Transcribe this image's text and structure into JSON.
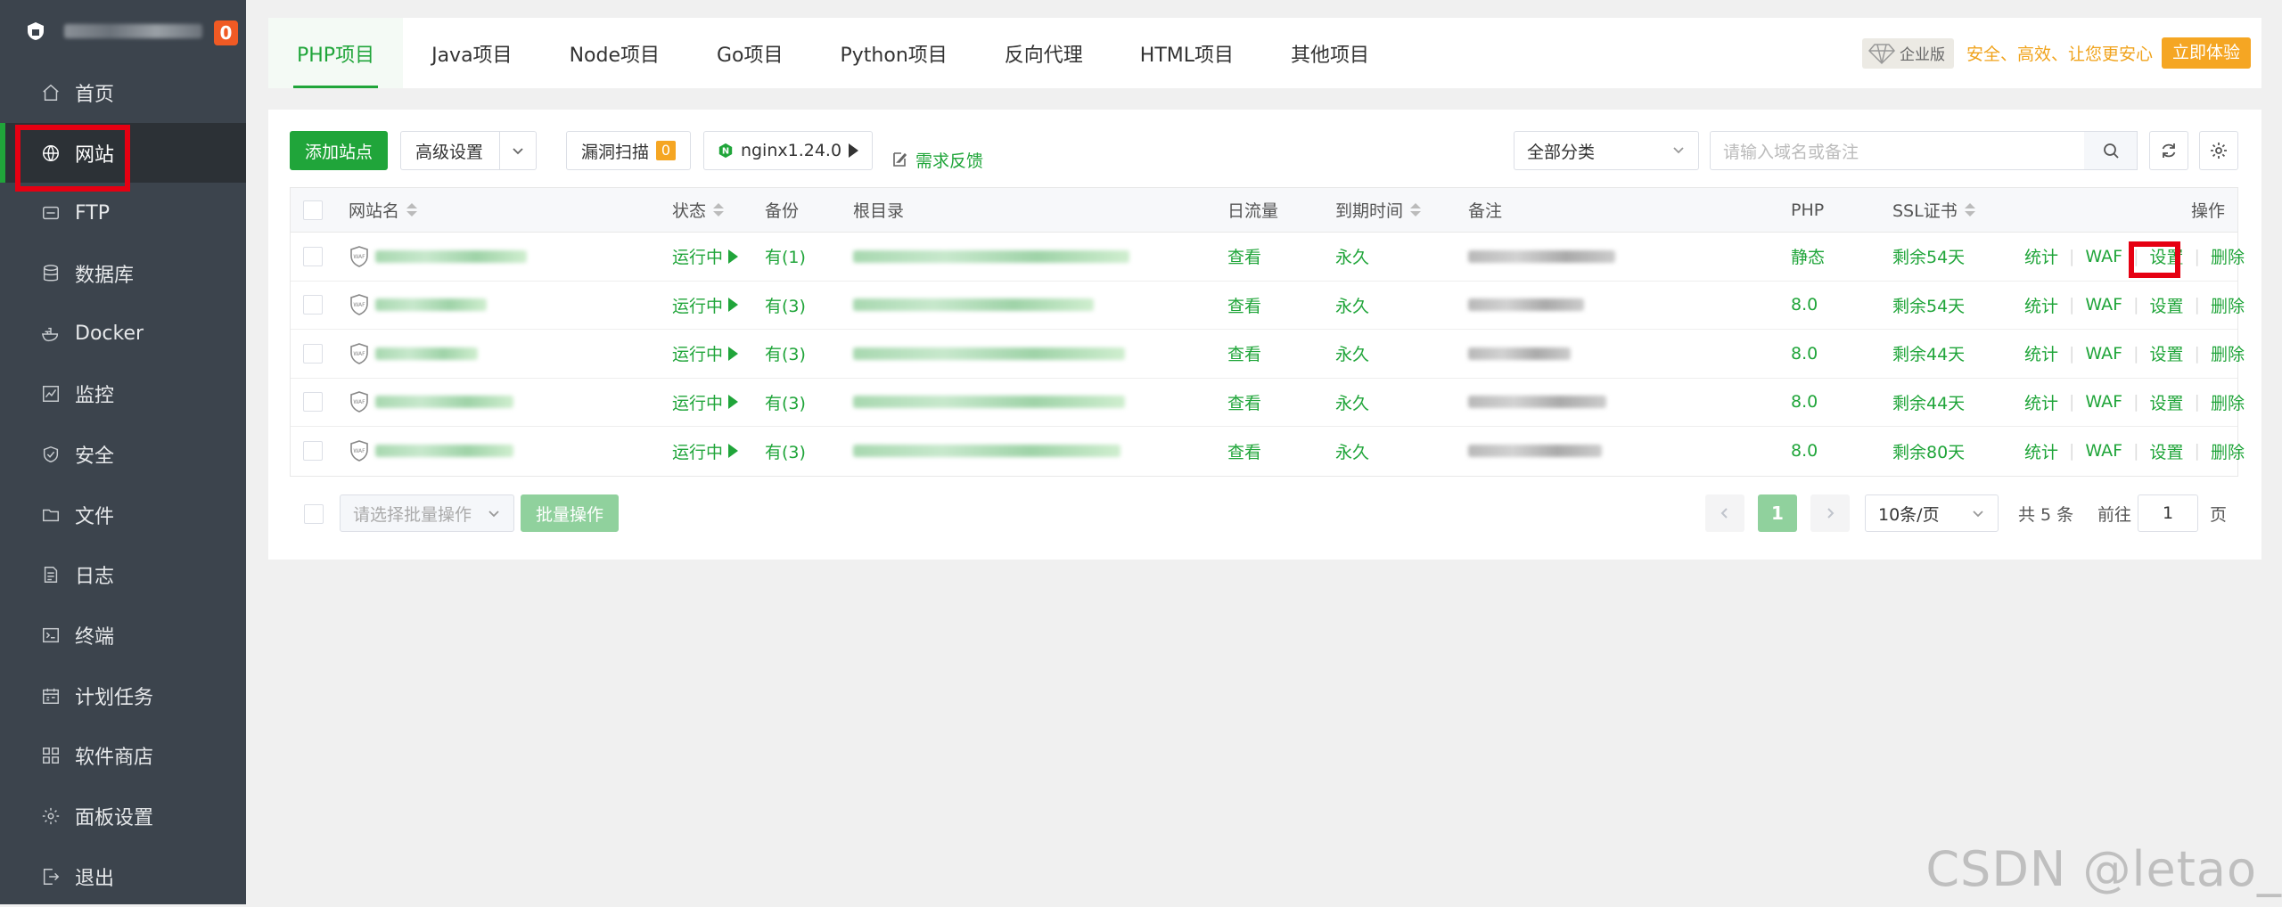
{
  "sidebar": {
    "badge": "0",
    "items": [
      {
        "label": "首页",
        "icon": "home-icon"
      },
      {
        "label": "网站",
        "icon": "globe-icon",
        "active": true
      },
      {
        "label": "FTP",
        "icon": "ftp-icon"
      },
      {
        "label": "数据库",
        "icon": "database-icon"
      },
      {
        "label": "Docker",
        "icon": "docker-icon"
      },
      {
        "label": "监控",
        "icon": "monitor-icon"
      },
      {
        "label": "安全",
        "icon": "shield-icon"
      },
      {
        "label": "文件",
        "icon": "folder-icon"
      },
      {
        "label": "日志",
        "icon": "log-icon"
      },
      {
        "label": "终端",
        "icon": "terminal-icon"
      },
      {
        "label": "计划任务",
        "icon": "calendar-icon"
      },
      {
        "label": "软件商店",
        "icon": "grid-icon"
      },
      {
        "label": "面板设置",
        "icon": "gear-icon"
      },
      {
        "label": "退出",
        "icon": "logout-icon"
      }
    ]
  },
  "tabs": [
    "PHP项目",
    "Java项目",
    "Node项目",
    "Go项目",
    "Python项目",
    "反向代理",
    "HTML项目",
    "其他项目"
  ],
  "promo": {
    "edition": "企业版",
    "slogan": "安全、高效、让您更安心",
    "button": "立即体验"
  },
  "toolbar": {
    "add_site": "添加站点",
    "advanced": "高级设置",
    "vuln_scan": "漏洞扫描",
    "vuln_count": "0",
    "nginx": "nginx1.24.0",
    "feedback": "需求反馈",
    "category": "全部分类",
    "search_placeholder": "请输入域名或备注"
  },
  "table": {
    "headers": {
      "name": "网站名",
      "status": "状态",
      "backup": "备份",
      "root": "根目录",
      "traffic": "日流量",
      "expire": "到期时间",
      "note": "备注",
      "php": "PHP",
      "ssl": "SSL证书",
      "ops": "操作"
    },
    "rows": [
      {
        "status": "运行中",
        "backup": "有(1)",
        "traffic": "查看",
        "expire": "永久",
        "php": "静态",
        "ssl": "剩余54天"
      },
      {
        "status": "运行中",
        "backup": "有(3)",
        "traffic": "查看",
        "expire": "永久",
        "php": "8.0",
        "ssl": "剩余54天"
      },
      {
        "status": "运行中",
        "backup": "有(3)",
        "traffic": "查看",
        "expire": "永久",
        "php": "8.0",
        "ssl": "剩余44天"
      },
      {
        "status": "运行中",
        "backup": "有(3)",
        "traffic": "查看",
        "expire": "永久",
        "php": "8.0",
        "ssl": "剩余44天"
      },
      {
        "status": "运行中",
        "backup": "有(3)",
        "traffic": "查看",
        "expire": "永久",
        "php": "8.0",
        "ssl": "剩余80天"
      }
    ],
    "ops": {
      "stats": "统计",
      "waf": "WAF",
      "settings": "设置",
      "delete": "删除"
    }
  },
  "footer": {
    "batch_placeholder": "请选择批量操作",
    "batch_button": "批量操作",
    "current_page": "1",
    "page_size": "10条/页",
    "total": "共 5 条",
    "goto_label": "前往",
    "goto_value": "1",
    "page_unit": "页"
  },
  "watermark": "CSDN @letao_",
  "colors": {
    "accent": "#20a53a",
    "sidebar": "#3c444d",
    "highlight": "#e60012",
    "promo": "#f5a623"
  }
}
